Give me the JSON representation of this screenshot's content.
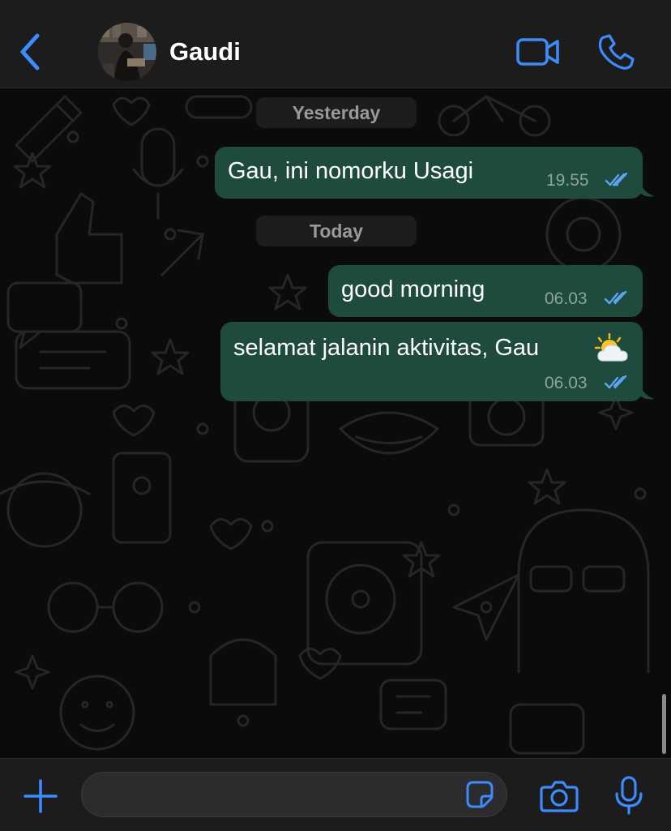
{
  "header": {
    "contact_name": "Gaudi",
    "back_icon": "chevron-left-icon",
    "video_icon": "video-camera-icon",
    "call_icon": "phone-icon"
  },
  "chat": {
    "date_separators": [
      {
        "label": "Yesterday"
      },
      {
        "label": "Today"
      }
    ],
    "messages": [
      {
        "text": "Gau, ini nomorku Usagi",
        "time": "19.55",
        "status": "read",
        "direction": "outgoing"
      },
      {
        "text": "good morning",
        "time": "06.03",
        "status": "read",
        "direction": "outgoing"
      },
      {
        "text": "selamat jalanin aktivitas, Gau",
        "emoji": "sun-behind-cloud-emoji",
        "time": "06.03",
        "status": "read",
        "direction": "outgoing"
      }
    ]
  },
  "composer": {
    "input_value": "",
    "placeholder": "",
    "add_icon": "plus-icon",
    "sticker_icon": "sticker-icon",
    "camera_icon": "camera-icon",
    "mic_icon": "microphone-icon"
  },
  "colors": {
    "accent": "#3d8bfd",
    "bubble_outgoing": "#1f4a3e",
    "read_ticks": "#5aa6f0",
    "bar_background": "#1c1c1d"
  }
}
